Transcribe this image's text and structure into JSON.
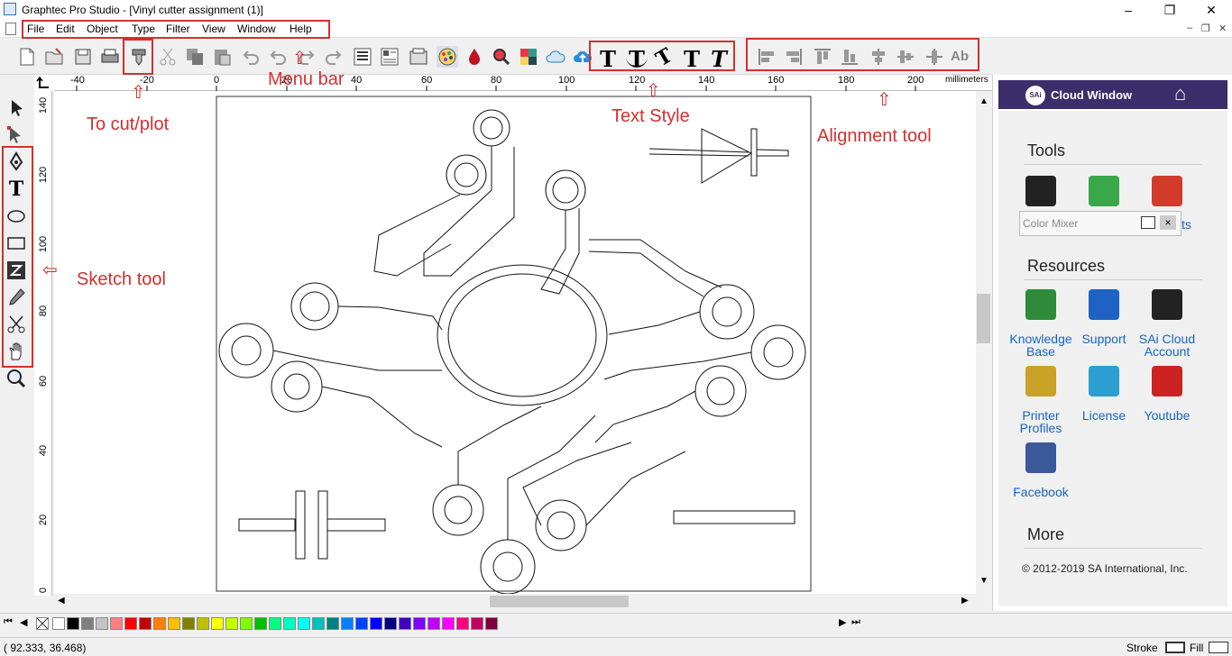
{
  "window": {
    "title": "Graphtec Pro Studio - [Vinyl cutter assignment (1)]",
    "minimize": "–",
    "maximize": "❐",
    "close": "✕"
  },
  "menu": {
    "items": [
      "File",
      "Edit",
      "Object",
      "Type",
      "Filter",
      "View",
      "Window",
      "Help"
    ],
    "mdi_min": "–",
    "mdi_restore": "❐",
    "mdi_close": "✕"
  },
  "toolbar": {
    "icons": [
      "new-document-icon",
      "open-icon",
      "save-icon",
      "print-icon",
      "cut-plot-icon",
      "scissors-icon",
      "copy-icon",
      "paste-icon",
      "undo-icon",
      "undo-alt-icon",
      "redo-icon",
      "redo-alt-icon",
      "barcode-icon",
      "layout-icon",
      "media-icon",
      "color-wheel-icon",
      "color-drop-icon",
      "search-color-icon",
      "color-grid-icon",
      "cloud-sync-icon",
      "cloud-upload-icon"
    ],
    "text_style_icons": [
      "text-icon",
      "text-arc-icon",
      "text-path-icon",
      "text-vertical-icon",
      "text-italic-icon"
    ],
    "text_glyphs": [
      "T",
      "T",
      "T",
      "T",
      "T"
    ],
    "align_icons": [
      "align-left-icon",
      "align-right-icon",
      "align-top-icon",
      "align-bottom-icon",
      "center-horizontal-icon",
      "center-vertical-icon",
      "distribute-icon",
      "align-text-icon"
    ],
    "align_text_glyph": "Ab"
  },
  "ruler": {
    "h_labels": [
      "-40",
      "-20",
      "0",
      "20",
      "40",
      "60",
      "80",
      "100",
      "120",
      "140",
      "160",
      "180",
      "200"
    ],
    "h_unit": "millimeters",
    "v_labels": [
      "140",
      "120",
      "100",
      "80",
      "60",
      "40",
      "20",
      "0"
    ]
  },
  "tools": [
    "select-arrow-icon",
    "node-edit-icon",
    "pen-tool-icon",
    "text-tool-icon",
    "ellipse-tool-icon",
    "rectangle-tool-icon",
    "z-tool-icon",
    "eyedropper-icon",
    "knife-icon",
    "hand-pan-icon",
    "zoom-icon"
  ],
  "annotations": {
    "menu_bar": "Menu bar",
    "cut_plot": "To cut/plot",
    "text_style": "Text Style",
    "alignment": "Alignment tool",
    "sketch": "Sketch tool",
    "arrow_up": "⇧",
    "arrow_left": "⇦"
  },
  "cloud": {
    "header_logo": "SAi",
    "header_title": "Cloud Window",
    "home_icon": "⌂",
    "tools_title": "Tools",
    "color_mixer": "Color Mixer",
    "color_mixer_close": "✕",
    "partial_label": "ts",
    "resources_title": "Resources",
    "resources": [
      {
        "line1": "Knowledge",
        "line2": "Base",
        "icon": "knowledge-base-icon",
        "color": "#2e8b3a"
      },
      {
        "line1": "Support",
        "line2": "",
        "icon": "support-icon",
        "color": "#1e63c4"
      },
      {
        "line1": "SAi Cloud",
        "line2": "Account",
        "icon": "sai-cloud-account-icon",
        "color": "#222222"
      },
      {
        "line1": "Printer",
        "line2": "Profiles",
        "icon": "printer-profiles-icon",
        "color": "#c9a227"
      },
      {
        "line1": "License",
        "line2": "",
        "icon": "license-icon",
        "color": "#2a9fd0"
      },
      {
        "line1": "Youtube",
        "line2": "",
        "icon": "youtube-icon",
        "color": "#cc2222"
      },
      {
        "line1": "Facebook",
        "line2": "",
        "icon": "facebook-icon",
        "color": "#3b5998"
      }
    ],
    "more_title": "More",
    "copyright": "© 2012-2019 SA International, Inc."
  },
  "palette": {
    "colors": [
      "#ffffff",
      "#000000",
      "#7f7f7f",
      "#c3c3c3",
      "#ff8080",
      "#ff0000",
      "#c00000",
      "#ff8000",
      "#ffbf00",
      "#808000",
      "#c0c000",
      "#ffff00",
      "#c0ff00",
      "#80ff00",
      "#00c000",
      "#00ff80",
      "#00ffc0",
      "#00ffff",
      "#00c0c0",
      "#008080",
      "#0080ff",
      "#0040ff",
      "#0000ff",
      "#000080",
      "#4000c0",
      "#8000ff",
      "#c000ff",
      "#ff00ff",
      "#ff0080",
      "#c00060",
      "#800040"
    ]
  },
  "status": {
    "coords": "(   92.333,      36.468)",
    "stroke_label": "Stroke",
    "fill_label": "Fill"
  }
}
